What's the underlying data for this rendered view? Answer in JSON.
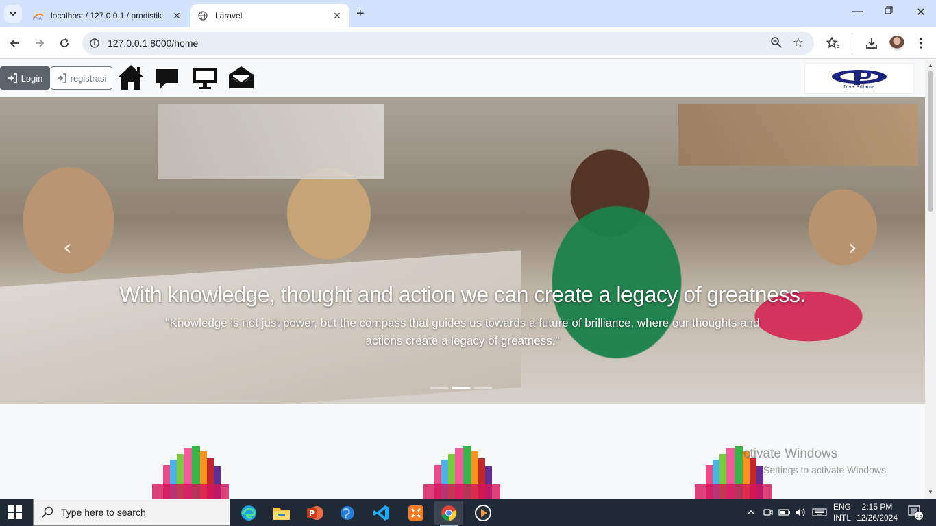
{
  "browser": {
    "tabs": [
      {
        "title": "localhost / 127.0.0.1 / prodistik",
        "active": false
      },
      {
        "title": "Laravel",
        "active": true
      }
    ],
    "url": "127.0.0.1:8000/home"
  },
  "page": {
    "header": {
      "login_label": "Login",
      "register_label": "registrasi",
      "nav_icons": [
        "home-icon",
        "comment-icon",
        "desktop-icon",
        "envelope-open-icon"
      ],
      "logo_text": "Diva Pdfama"
    },
    "carousel": {
      "title": "With knowledge, thought and action we can create a legacy of greatness.",
      "subtitle": "\"Knowledge is not just power, but the compass that guides us towards a future of brilliance, where our thoughts and actions create a legacy of greatness.\"",
      "slide_count": 3,
      "active_slide": 2
    }
  },
  "watermark": {
    "line1": "ctivate Windows",
    "line2": "Settings to activate Windows."
  },
  "taskbar": {
    "search_placeholder": "Type here to search",
    "apps": [
      "edge-icon",
      "file-explorer-icon",
      "powerpoint-icon",
      "globe-app-icon",
      "vscode-icon",
      "xampp-icon",
      "chrome-icon",
      "media-player-icon"
    ],
    "lang_line1": "ENG",
    "lang_line2": "INTL",
    "time": "2:15 PM",
    "date": "12/26/2024",
    "notification_count": "18"
  },
  "colors": {
    "tabstrip": "#d3e3fd",
    "login_button": "#5c636a",
    "taskbar": "#1f2a36"
  }
}
